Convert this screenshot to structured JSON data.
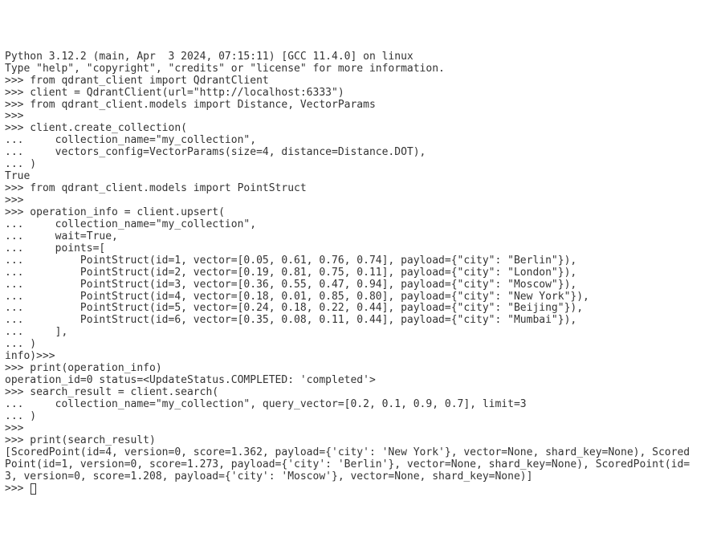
{
  "lines": [
    "Python 3.12.2 (main, Apr  3 2024, 07:15:11) [GCC 11.4.0] on linux",
    "Type \"help\", \"copyright\", \"credits\" or \"license\" for more information.",
    ">>> from qdrant_client import QdrantClient",
    ">>> client = QdrantClient(url=\"http://localhost:6333\")",
    ">>> from qdrant_client.models import Distance, VectorParams",
    ">>> ",
    ">>> client.create_collection(",
    "...     collection_name=\"my_collection\",",
    "...     vectors_config=VectorParams(size=4, distance=Distance.DOT),",
    "... )",
    "True",
    ">>> from qdrant_client.models import PointStruct",
    ">>> ",
    ">>> operation_info = client.upsert(",
    "...     collection_name=\"my_collection\",",
    "...     wait=True,",
    "...     points=[",
    "...         PointStruct(id=1, vector=[0.05, 0.61, 0.76, 0.74], payload={\"city\": \"Berlin\"}),",
    "...         PointStruct(id=2, vector=[0.19, 0.81, 0.75, 0.11], payload={\"city\": \"London\"}),",
    "...         PointStruct(id=3, vector=[0.36, 0.55, 0.47, 0.94], payload={\"city\": \"Moscow\"}),",
    "...         PointStruct(id=4, vector=[0.18, 0.01, 0.85, 0.80], payload={\"city\": \"New York\"}),",
    "...         PointStruct(id=5, vector=[0.24, 0.18, 0.22, 0.44], payload={\"city\": \"Beijing\"}),",
    "...         PointStruct(id=6, vector=[0.35, 0.08, 0.11, 0.44], payload={\"city\": \"Mumbai\"}),",
    "...     ],",
    "... )",
    "info)>>> ",
    ">>> print(operation_info)",
    "operation_id=0 status=<UpdateStatus.COMPLETED: 'completed'>",
    ">>> search_result = client.search(",
    "...     collection_name=\"my_collection\", query_vector=[0.2, 0.1, 0.9, 0.7], limit=3",
    "... )",
    ">>> ",
    ">>> print(search_result)",
    "[ScoredPoint(id=4, version=0, score=1.362, payload={'city': 'New York'}, vector=None, shard_key=None), Scored",
    "Point(id=1, version=0, score=1.273, payload={'city': 'Berlin'}, vector=None, shard_key=None), ScoredPoint(id=",
    "3, version=0, score=1.208, payload={'city': 'Moscow'}, vector=None, shard_key=None)]",
    ">>> "
  ]
}
